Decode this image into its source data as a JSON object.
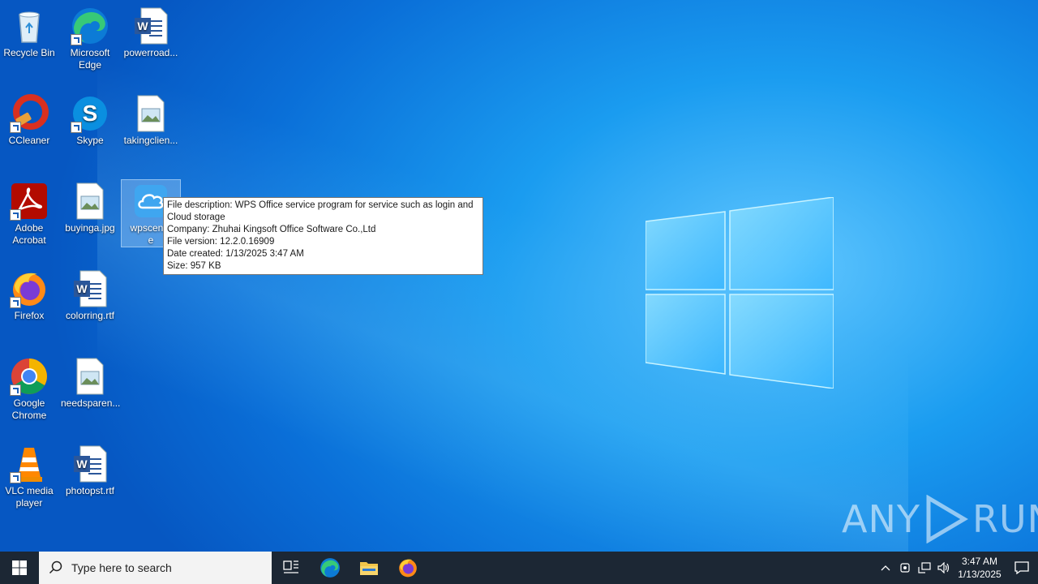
{
  "desktop": {
    "icons": [
      {
        "id": "recycle-bin",
        "label": "Recycle Bin"
      },
      {
        "id": "microsoft-edge",
        "label": "Microsoft Edge"
      },
      {
        "id": "powerroad",
        "label": "powerroad..."
      },
      {
        "id": "ccleaner",
        "label": "CCleaner"
      },
      {
        "id": "skype",
        "label": "Skype"
      },
      {
        "id": "takingclien",
        "label": "takingclien..."
      },
      {
        "id": "adobe-acrobat",
        "label": "Adobe Acrobat"
      },
      {
        "id": "buyinga",
        "label": "buyinga.jpg"
      },
      {
        "id": "wpscenter",
        "label": "wpscenta e"
      },
      {
        "id": "firefox",
        "label": "Firefox"
      },
      {
        "id": "colorring",
        "label": "colorring.rtf"
      },
      {
        "id": "google-chrome",
        "label": "Google Chrome"
      },
      {
        "id": "needsparen",
        "label": "needsparen..."
      },
      {
        "id": "vlc",
        "label": "VLC media player"
      },
      {
        "id": "photopst",
        "label": "photopst.rtf"
      }
    ]
  },
  "tooltip": {
    "description": "File description: WPS Office service program for service such as login and",
    "description_cont": "Cloud storage",
    "company": "Company: Zhuhai Kingsoft Office Software Co.,Ltd",
    "version": "File version: 12.2.0.16909",
    "date": "Date created: 1/13/2025 3:47 AM",
    "size": "Size: 957 KB"
  },
  "watermark": {
    "left": "ANY",
    "right": "RUN"
  },
  "taskbar": {
    "search_placeholder": "Type here to search",
    "clock_time": "3:47 AM",
    "clock_date": "1/13/2025",
    "pinned": [
      "task-view",
      "microsoft-edge",
      "file-explorer",
      "firefox"
    ]
  },
  "colors": {
    "taskbar": "#1c2734",
    "desktop_accent": "#0a6fd8",
    "tooltip_bg": "#ffffff"
  }
}
